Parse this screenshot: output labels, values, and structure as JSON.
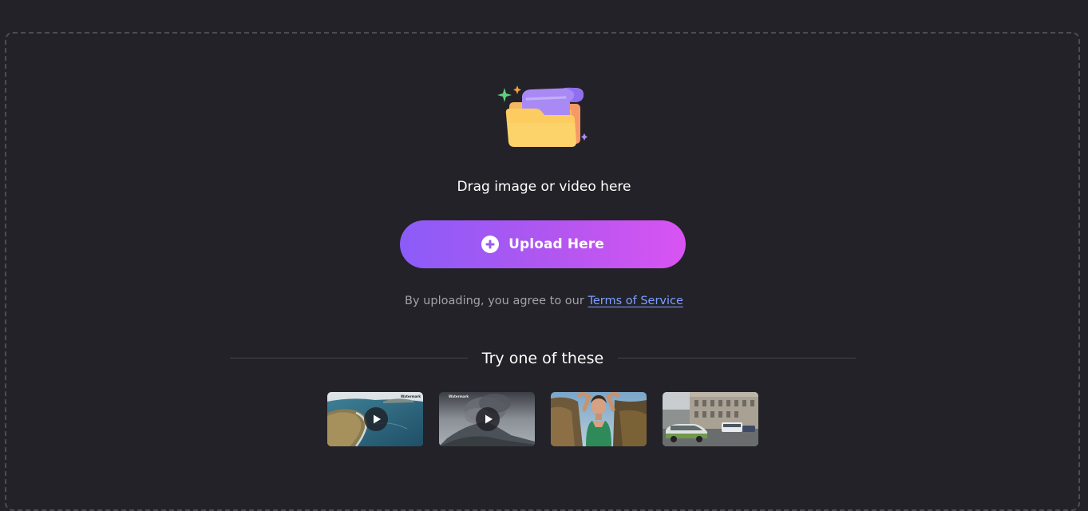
{
  "upload_area": {
    "drag_text": "Drag image or video here",
    "button_label": "Upload Here",
    "terms_prefix": "By uploading, you agree to our ",
    "terms_link": "Terms of Service"
  },
  "samples": {
    "heading": "Try one of these",
    "items": [
      {
        "kind": "video",
        "subject": "coastal cliffs aerial",
        "watermark": "Watermark"
      },
      {
        "kind": "video",
        "subject": "volcano smoke",
        "watermark": "Watermark"
      },
      {
        "kind": "image",
        "subject": "woman portrait on rocks"
      },
      {
        "kind": "image",
        "subject": "city street with cars"
      }
    ]
  },
  "colors": {
    "background": "#232228",
    "button_gradient_start": "#8b5cf8",
    "button_gradient_end": "#d954f2",
    "link": "#7ea0ff"
  },
  "icons": {
    "illustration": "folder-with-files-icon",
    "button": "plus-circle-icon",
    "play": "play-icon"
  }
}
